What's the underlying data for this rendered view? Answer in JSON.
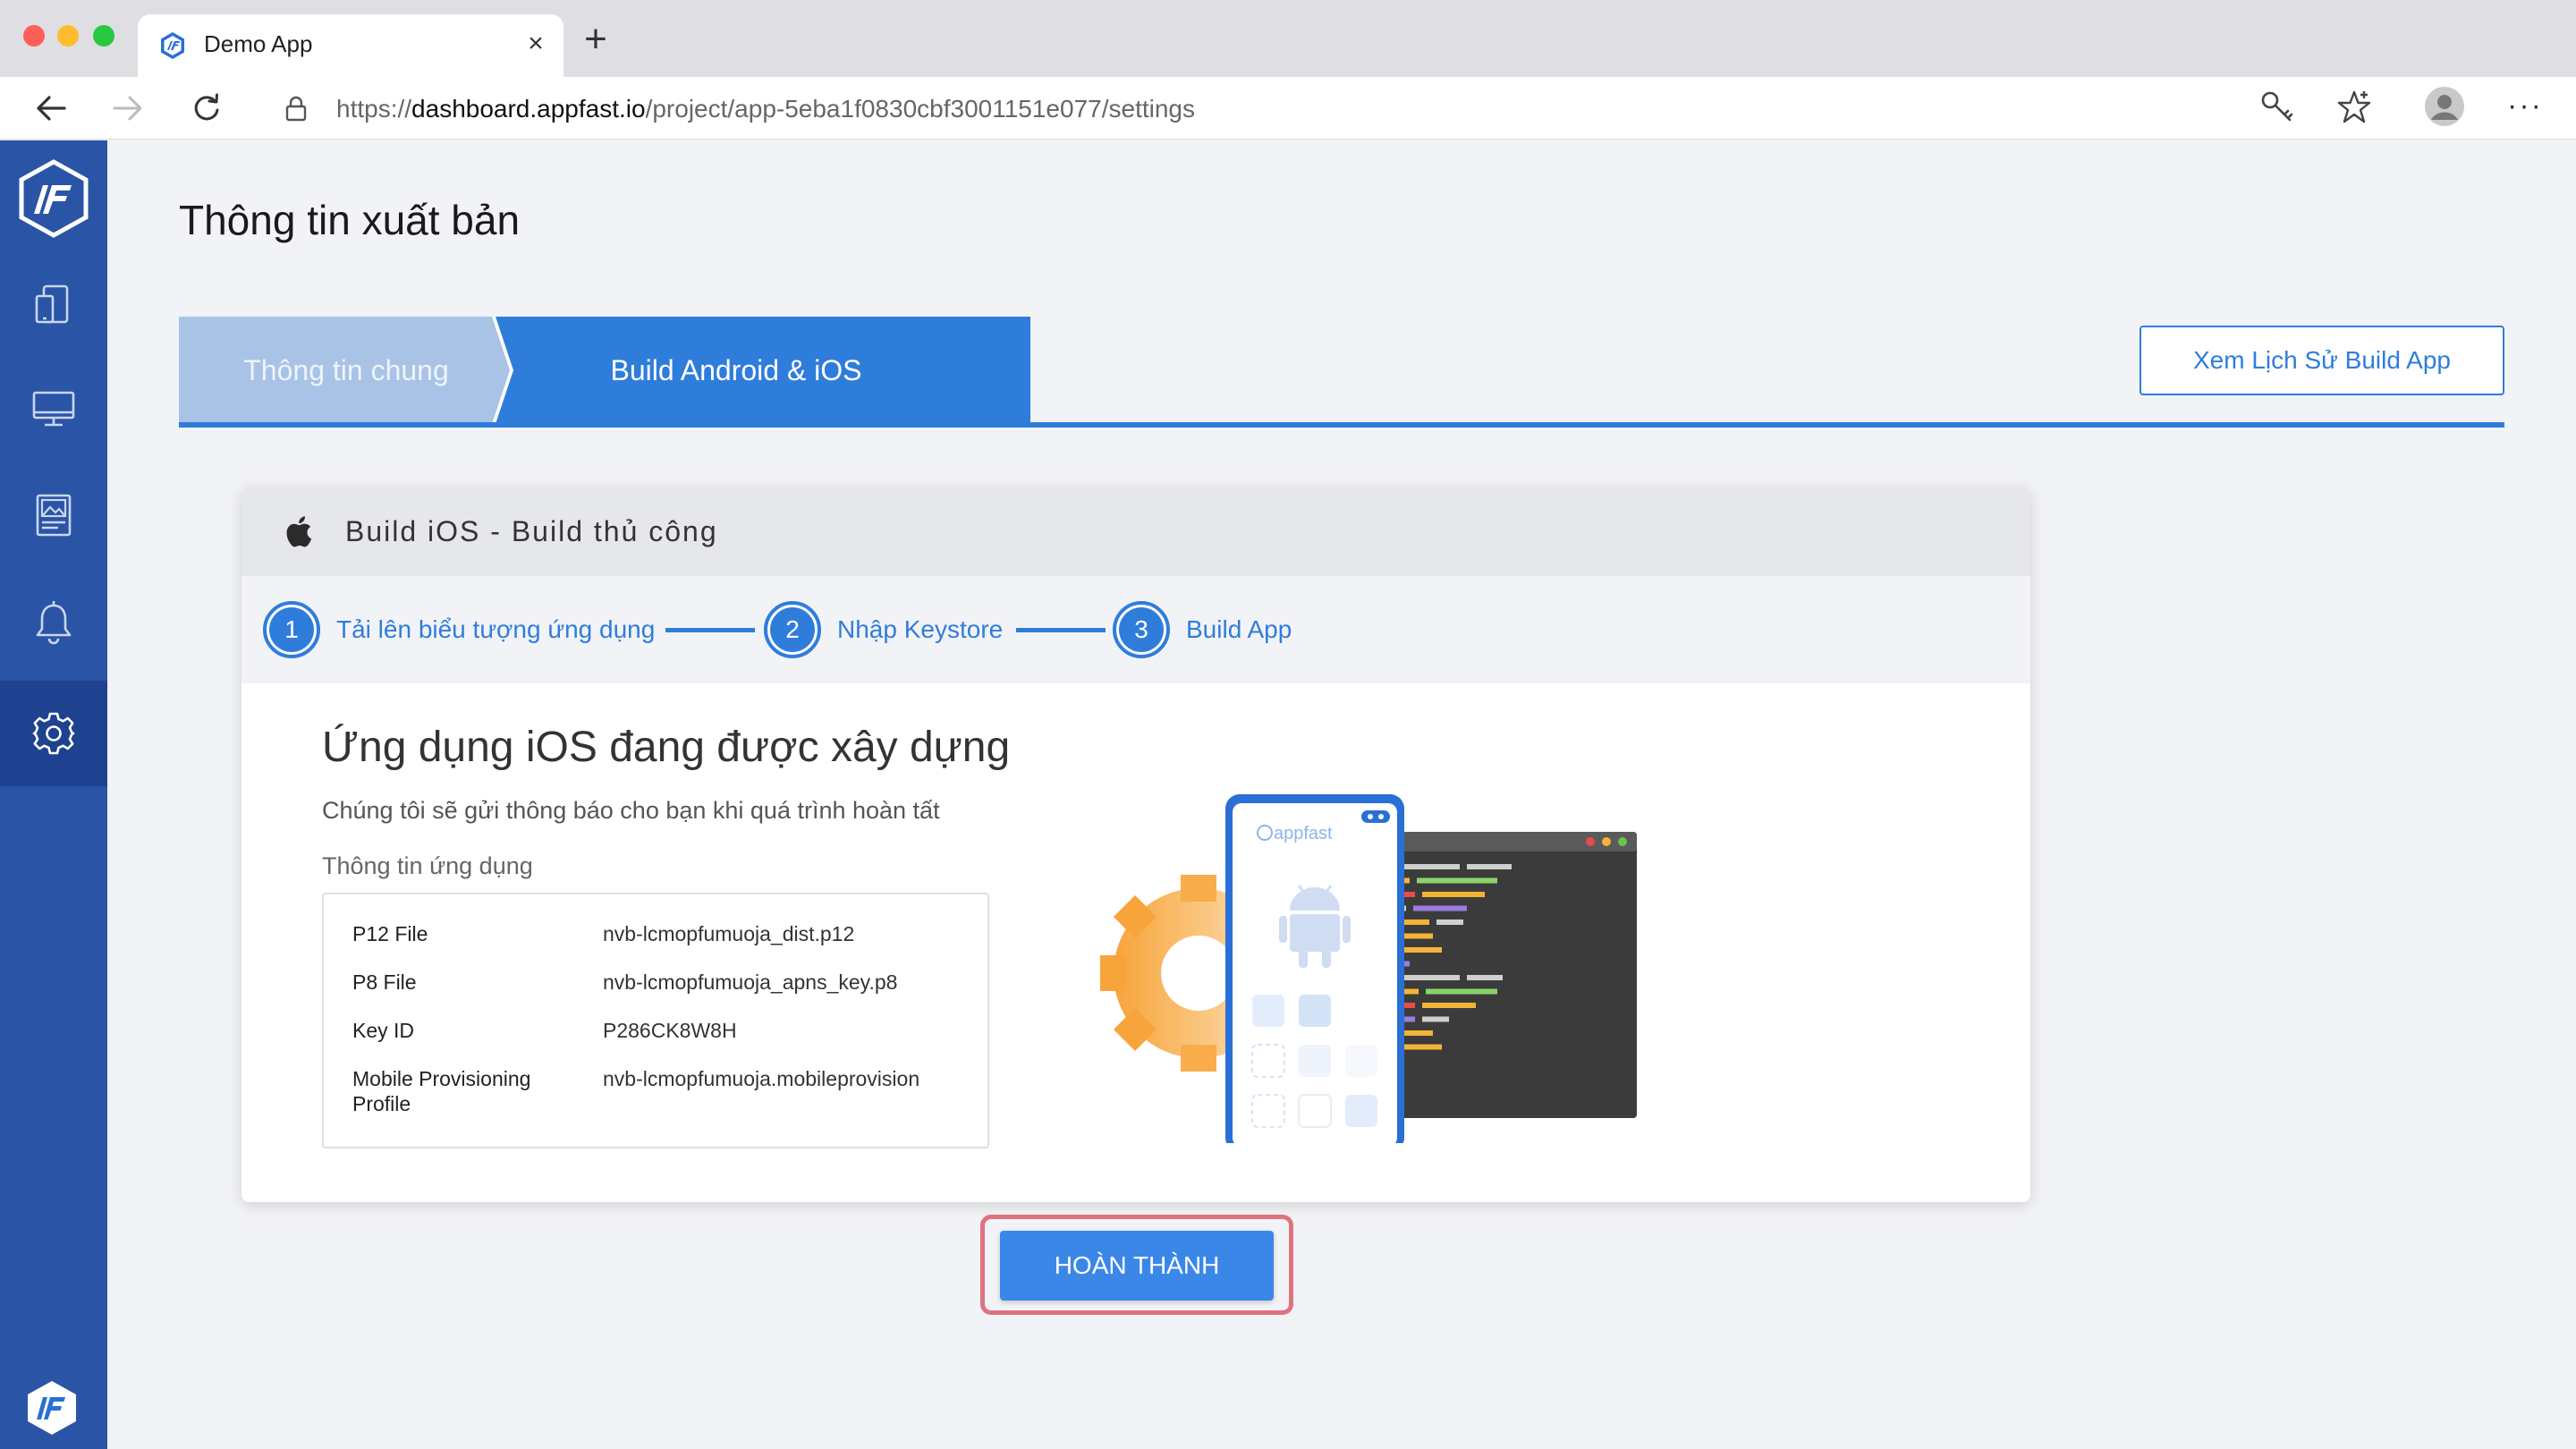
{
  "browser": {
    "tab_title": "Demo App",
    "close_symbol": "×",
    "new_tab_symbol": "+",
    "more_symbol": "···",
    "url_scheme": "https://",
    "url_host": "dashboard.appfast.io",
    "url_path": "/project/app-5eba1f0830cbf3001151e077/settings"
  },
  "sidebar": {
    "items": [
      {
        "icon": "devices-icon"
      },
      {
        "icon": "monitor-icon"
      },
      {
        "icon": "image-icon"
      },
      {
        "icon": "bell-icon"
      },
      {
        "icon": "gear-icon",
        "active": true
      }
    ]
  },
  "page": {
    "title": "Thông tin xuất bản",
    "tabs": [
      {
        "label": "Thông tin chung",
        "active": false
      },
      {
        "label": "Build Android & iOS",
        "active": true
      }
    ],
    "history_button": "Xem Lịch Sử Build App"
  },
  "card": {
    "title": "Build iOS - Build thủ công",
    "steps": [
      {
        "number": "1",
        "label": "Tải lên biểu tượng ứng dụng"
      },
      {
        "number": "2",
        "label": "Nhập Keystore"
      },
      {
        "number": "3",
        "label": "Build App"
      }
    ],
    "status_title": "Ứng dụng iOS đang được xây dựng",
    "status_subtitle": "Chúng tôi sẽ gửi thông báo cho bạn khi quá trình hoàn tất",
    "info_label": "Thông tin ứng dụng",
    "info_rows": [
      {
        "key": "P12 File",
        "value": "nvb-lcmopfumuoja_dist.p12"
      },
      {
        "key": "P8 File",
        "value": "nvb-lcmopfumuoja_apns_key.p8"
      },
      {
        "key": "Key ID",
        "value": "P286CK8W8H"
      },
      {
        "key": "Mobile Provisioning Profile",
        "value": "nvb-lcmopfumuoja.mobileprovision"
      }
    ],
    "illustration_brand": "appfast"
  },
  "done_button": "HOÀN THÀNH",
  "colors": {
    "sidebar": "#2a54a6",
    "accent": "#2f7ddb",
    "tab_inactive": "#a9c3e6",
    "highlight": "#e0727f"
  }
}
